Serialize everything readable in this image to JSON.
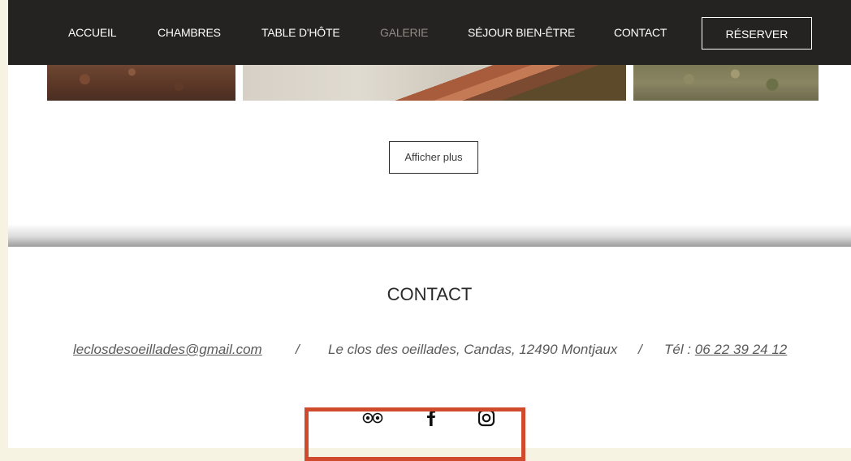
{
  "nav": {
    "items": [
      {
        "label": "ACCUEIL",
        "active": false
      },
      {
        "label": "CHAMBRES",
        "active": false
      },
      {
        "label": "TABLE D'HÔTE",
        "active": false
      },
      {
        "label": "GALERIE",
        "active": true
      },
      {
        "label": "SÉJOUR BIEN-ÊTRE",
        "active": false
      },
      {
        "label": "CONTACT",
        "active": false
      }
    ],
    "reserve_label": "RÉSERVER",
    "background": "#252321",
    "active_color": "#8f8a84"
  },
  "gallery": {
    "more_label": "Afficher plus"
  },
  "contact": {
    "title": "CONTACT",
    "email": "leclosdesoeillades@gmail.com",
    "separator": "/",
    "address": "Le clos des oeillades, Candas, 12490 Montjaux",
    "phone_prefix": "Tél : ",
    "phone": "06 22 39 24 12"
  },
  "social": {
    "icons": [
      "tripadvisor-icon",
      "facebook-icon",
      "instagram-icon"
    ]
  },
  "highlight_color": "#d04b2e"
}
